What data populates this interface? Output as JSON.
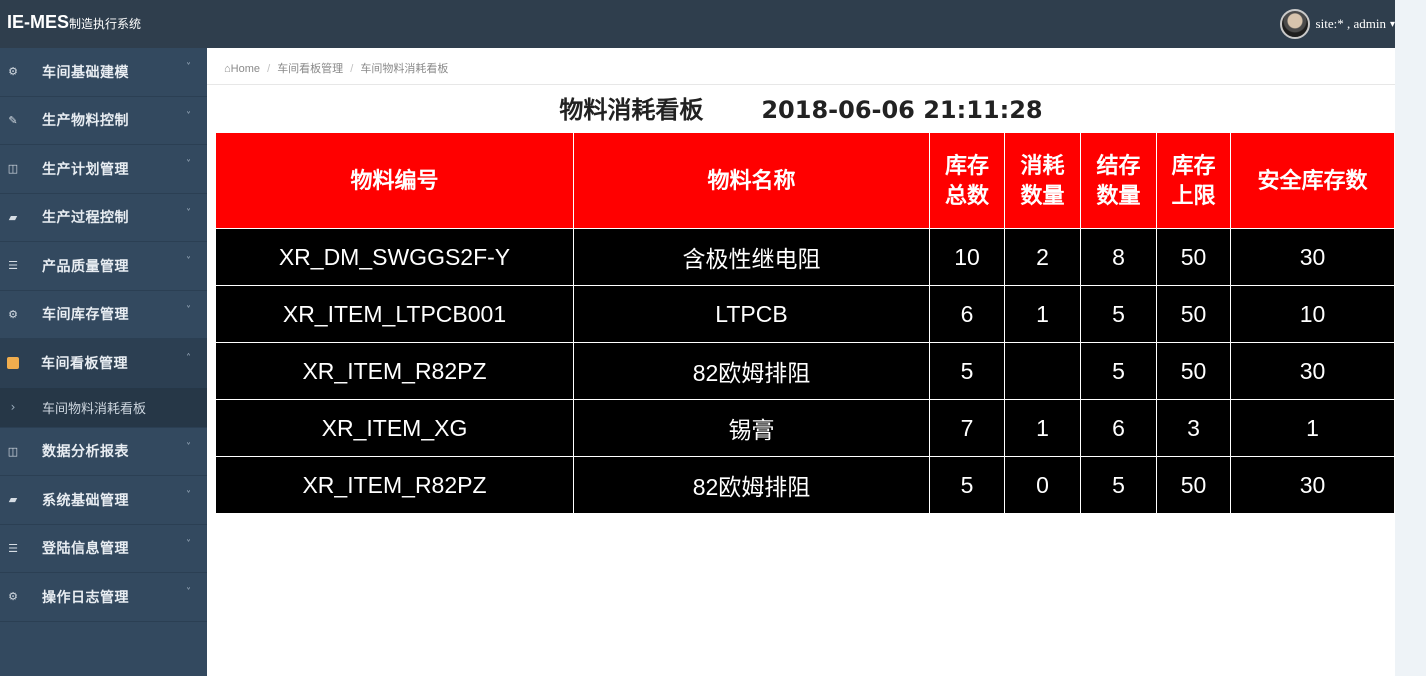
{
  "topbar": {
    "brand": "IE-MES",
    "brand_sub": "制造执行系统",
    "user_text": "site:* , admin",
    "caret": "▾"
  },
  "sidebar": {
    "items": [
      {
        "label": "车间基础建模",
        "icon": "⚙",
        "chev": "˅"
      },
      {
        "label": "生产物料控制",
        "icon": "✎",
        "chev": "˅"
      },
      {
        "label": "生产计划管理",
        "icon": "◫",
        "chev": "˅"
      },
      {
        "label": "生产过程控制",
        "icon": "▰",
        "chev": "˅"
      },
      {
        "label": "产品质量管理",
        "icon": "☰",
        "chev": "˅"
      },
      {
        "label": "车间库存管理",
        "icon": "⚙",
        "chev": "˅"
      },
      {
        "label": "车间看板管理",
        "icon": "",
        "chev": "˄"
      },
      {
        "label": "车间物料消耗看板",
        "icon": "›"
      },
      {
        "label": "数据分析报表",
        "icon": "◫",
        "chev": "˅"
      },
      {
        "label": "系统基础管理",
        "icon": "▰",
        "chev": "˅"
      },
      {
        "label": "登陆信息管理",
        "icon": "☰",
        "chev": "˅"
      },
      {
        "label": "操作日志管理",
        "icon": "⚙",
        "chev": "˅"
      }
    ]
  },
  "breadcrumb": {
    "home_icon": "⌂",
    "home": "Home",
    "sep": "/",
    "level1": "车间看板管理",
    "level2": "车间物料消耗看板"
  },
  "board": {
    "title": "物料消耗看板",
    "timestamp": "2018-06-06 21:11:28",
    "headers": [
      "物料编号",
      "物料名称",
      "库存\n总数",
      "消耗\n数量",
      "结存\n数量",
      "库存\n上限",
      "安全库存数"
    ],
    "rows": [
      [
        "XR_DM_SWGGS2F-Y",
        "含极性继电阻",
        "10",
        "2",
        "8",
        "50",
        "30"
      ],
      [
        "XR_ITEM_LTPCB001",
        "LTPCB",
        "6",
        "1",
        "5",
        "50",
        "10"
      ],
      [
        "XR_ITEM_R82PZ",
        "82欧姆排阻",
        "5",
        "",
        "5",
        "50",
        "30"
      ],
      [
        "XR_ITEM_XG",
        "锡膏",
        "7",
        "1",
        "6",
        "3",
        "1"
      ],
      [
        "XR_ITEM_R82PZ",
        "82欧姆排阻",
        "5",
        "0",
        "5",
        "50",
        "30"
      ]
    ]
  },
  "colors": {
    "topbar": "#2f3e4d",
    "sidebar": "#33495f",
    "active_icon": "#f0ad4e",
    "header_bg": "#ff0000",
    "row_bg": "#000000"
  }
}
